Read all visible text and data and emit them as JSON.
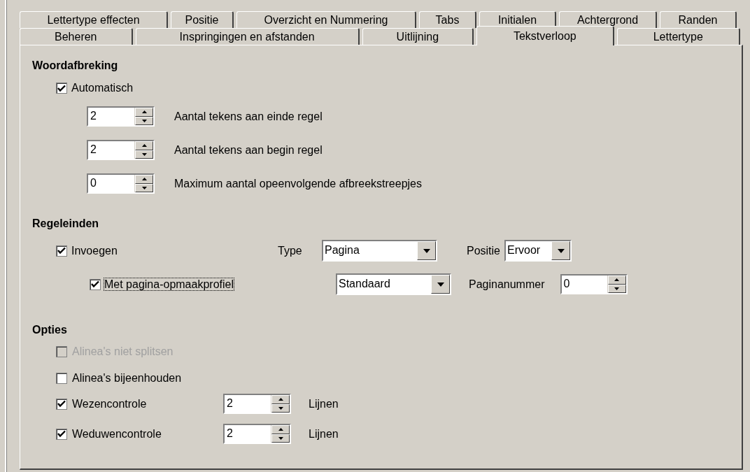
{
  "tabs": [
    [
      {
        "label": "Lettertype effecten",
        "selected": false
      },
      {
        "label": "Positie",
        "selected": false
      },
      {
        "label": "Overzicht en Nummering",
        "selected": false
      },
      {
        "label": "Tabs",
        "selected": false
      },
      {
        "label": "Initialen",
        "selected": false
      },
      {
        "label": "Achtergrond",
        "selected": false
      },
      {
        "label": "Randen",
        "selected": false
      }
    ],
    [
      {
        "label": "Beheren",
        "selected": false
      },
      {
        "label": "Inspringingen en afstanden",
        "selected": false
      },
      {
        "label": "Uitlijning",
        "selected": false
      },
      {
        "label": "Tekstverloop",
        "selected": true
      },
      {
        "label": "Lettertype",
        "selected": false
      }
    ]
  ],
  "hyphenation": {
    "title": "Woordafbreking",
    "automatic": {
      "label": "Automatisch",
      "checked": true
    },
    "spinners": [
      {
        "value": "2",
        "label": "Aantal tekens aan einde regel"
      },
      {
        "value": "2",
        "label": "Aantal tekens aan begin regel"
      },
      {
        "value": "0",
        "label": "Maximum aantal opeenvolgende afbreekstreepjes"
      }
    ]
  },
  "breaks": {
    "title": "Regeleinden",
    "insert": {
      "label": "Invoegen",
      "checked": true
    },
    "type_label": "Type",
    "type_value": "Pagina",
    "position_label": "Positie",
    "position_value": "Ervoor",
    "page_style": {
      "label": "Met pagina-opmaakprofiel",
      "checked": true,
      "focused": true
    },
    "style_value": "Standaard",
    "page_number_label": "Paginanummer",
    "page_number_value": "0"
  },
  "options": {
    "title": "Opties",
    "items": [
      {
        "kind": "checkbox",
        "label": "Alinea's niet splitsen",
        "checked": false,
        "disabled": true
      },
      {
        "kind": "checkbox",
        "label": "Alinea's bijeenhouden",
        "checked": false,
        "disabled": false
      },
      {
        "kind": "spin",
        "label": "Wezencontrole",
        "checked": true,
        "disabled": false,
        "value": "2",
        "unit": "Lijnen"
      },
      {
        "kind": "spin",
        "label": "Weduwencontrole",
        "checked": true,
        "disabled": false,
        "value": "2",
        "unit": "Lijnen"
      }
    ]
  }
}
